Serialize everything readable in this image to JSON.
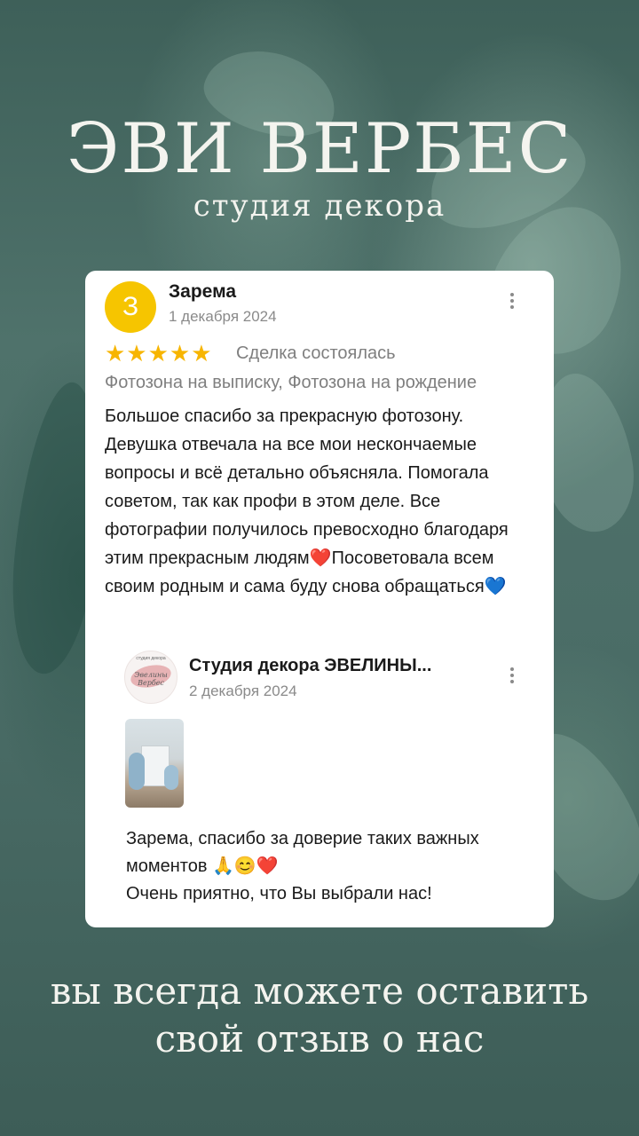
{
  "header": {
    "title": "ЭВИ ВЕРБЕС",
    "subtitle": "студия декора"
  },
  "review": {
    "avatar_letter": "З",
    "author": "Зарема",
    "date": "1 декабря 2024",
    "rating": 5,
    "stars": "★★★★★",
    "deal_status": "Сделка состоялась",
    "tags": "Фотозона на выписку, Фотозона на рождение",
    "text_part1": "Большое спасибо за прекрасную фотозону. Девушка отвечала на все мои нескончаемые вопросы и всё детально объясняла. Помогала советом, так как профи в этом деле. Все фотографии получилось превосходно благодаря этим прекрасным людям",
    "emoji1": "❤️",
    "text_part2": "Посоветовала всем своим родным и сама буду снова обращаться",
    "emoji2": "💙"
  },
  "reply": {
    "logo_small_text": "студия декора",
    "logo_script_text": "Эвелины Вербес",
    "author": "Студия декора ЭВЕЛИНЫ...",
    "date": "2 декабря 2024",
    "text_line1": "Зарема, спасибо за доверие таких важных моментов ",
    "emojis": "🙏😊❤️",
    "text_line2": "Очень приятно, что Вы выбрали нас!"
  },
  "footer": {
    "line1": "вы всегда можете оставить",
    "line2": "свой отзыв о нас"
  },
  "colors": {
    "avatar": "#f6c500",
    "stars": "#f7b500",
    "background": "#4a6a64"
  }
}
